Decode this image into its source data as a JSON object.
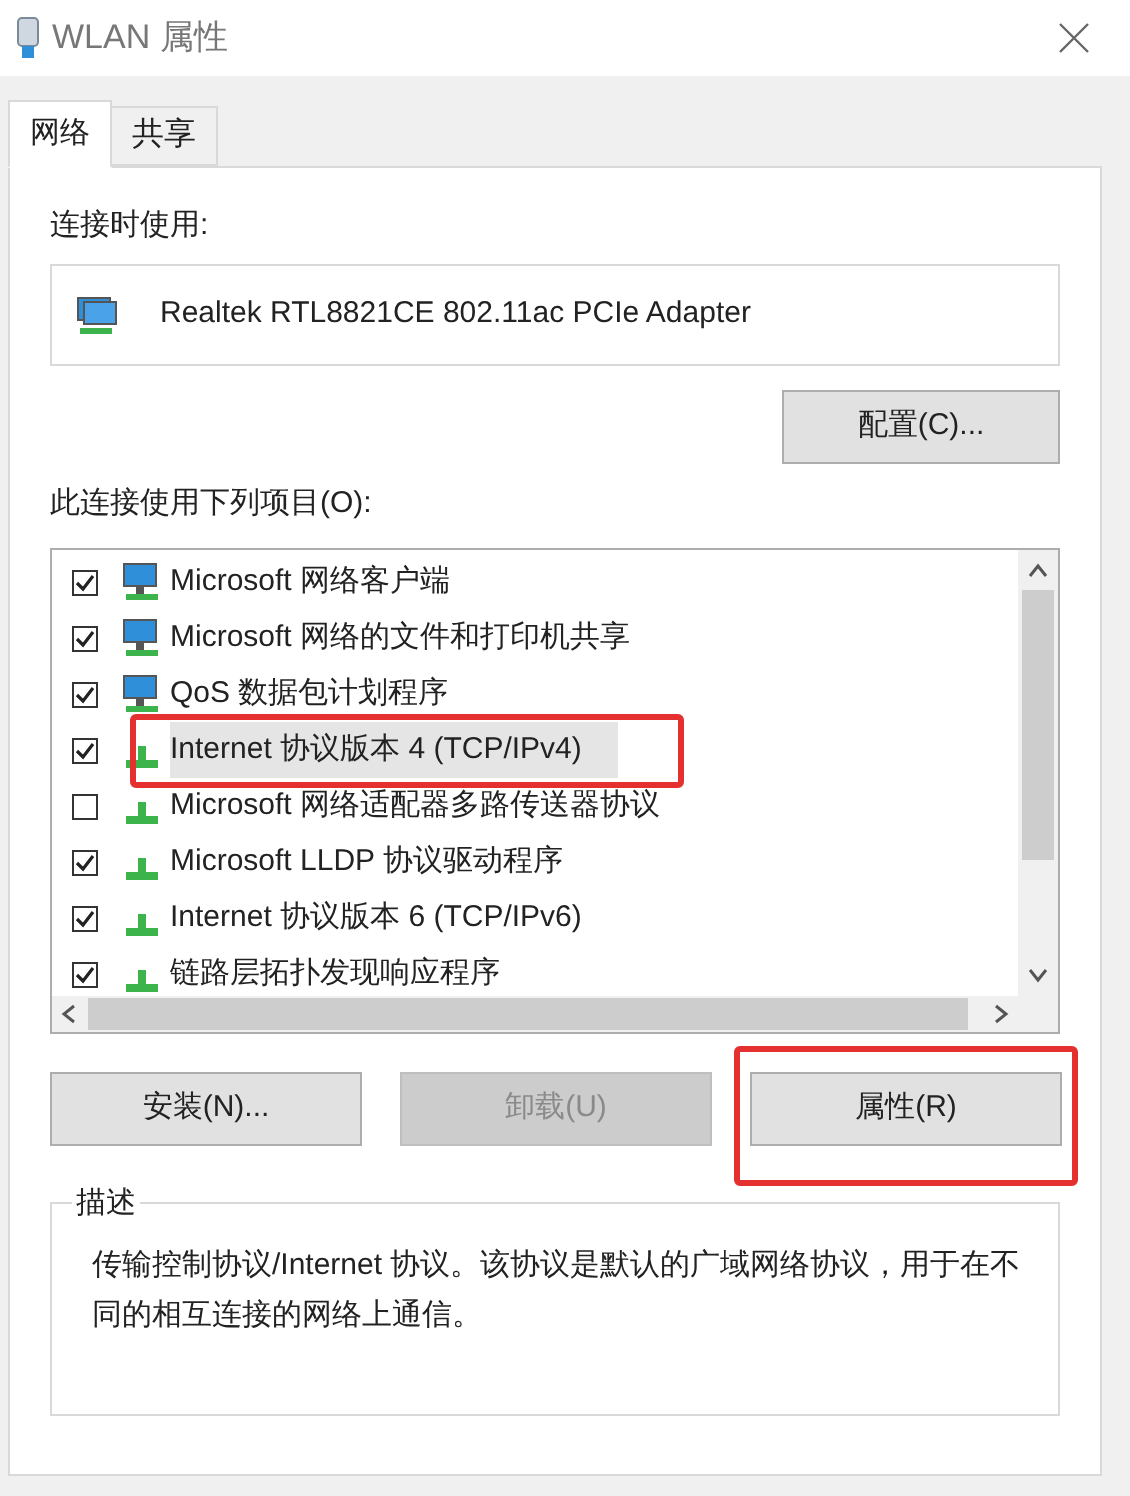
{
  "window": {
    "title": "WLAN 属性"
  },
  "tabs": [
    {
      "label": "网络",
      "selected": true
    },
    {
      "label": "共享",
      "selected": false
    }
  ],
  "connect_using": {
    "label": "连接时使用:",
    "adapter": "Realtek RTL8821CE 802.11ac PCIe Adapter",
    "configure_button": "配置(C)..."
  },
  "items_label": "此连接使用下列项目(O):",
  "items": [
    {
      "label": "Microsoft 网络客户端",
      "kind": "client",
      "checked": true,
      "selected": false,
      "highlighted": false
    },
    {
      "label": "Microsoft 网络的文件和打印机共享",
      "kind": "client",
      "checked": true,
      "selected": false,
      "highlighted": false
    },
    {
      "label": "QoS 数据包计划程序",
      "kind": "client",
      "checked": true,
      "selected": false,
      "highlighted": false
    },
    {
      "label": "Internet 协议版本 4 (TCP/IPv4)",
      "kind": "protocol",
      "checked": true,
      "selected": true,
      "highlighted": true
    },
    {
      "label": "Microsoft 网络适配器多路传送器协议",
      "kind": "protocol",
      "checked": false,
      "selected": false,
      "highlighted": false
    },
    {
      "label": "Microsoft LLDP 协议驱动程序",
      "kind": "protocol",
      "checked": true,
      "selected": false,
      "highlighted": false
    },
    {
      "label": "Internet 协议版本 6 (TCP/IPv6)",
      "kind": "protocol",
      "checked": true,
      "selected": false,
      "highlighted": false
    },
    {
      "label": "链路层拓扑发现响应程序",
      "kind": "protocol",
      "checked": true,
      "selected": false,
      "highlighted": false
    }
  ],
  "buttons": [
    {
      "label": "安装(N)...",
      "disabled": false,
      "highlighted": false
    },
    {
      "label": "卸载(U)",
      "disabled": true,
      "highlighted": false
    },
    {
      "label": "属性(R)",
      "disabled": false,
      "highlighted": true
    }
  ],
  "description": {
    "title": "描述",
    "text": "传输控制协议/Internet 协议。该协议是默认的广域网络协议，用于在不同的相互连接的网络上通信。"
  }
}
